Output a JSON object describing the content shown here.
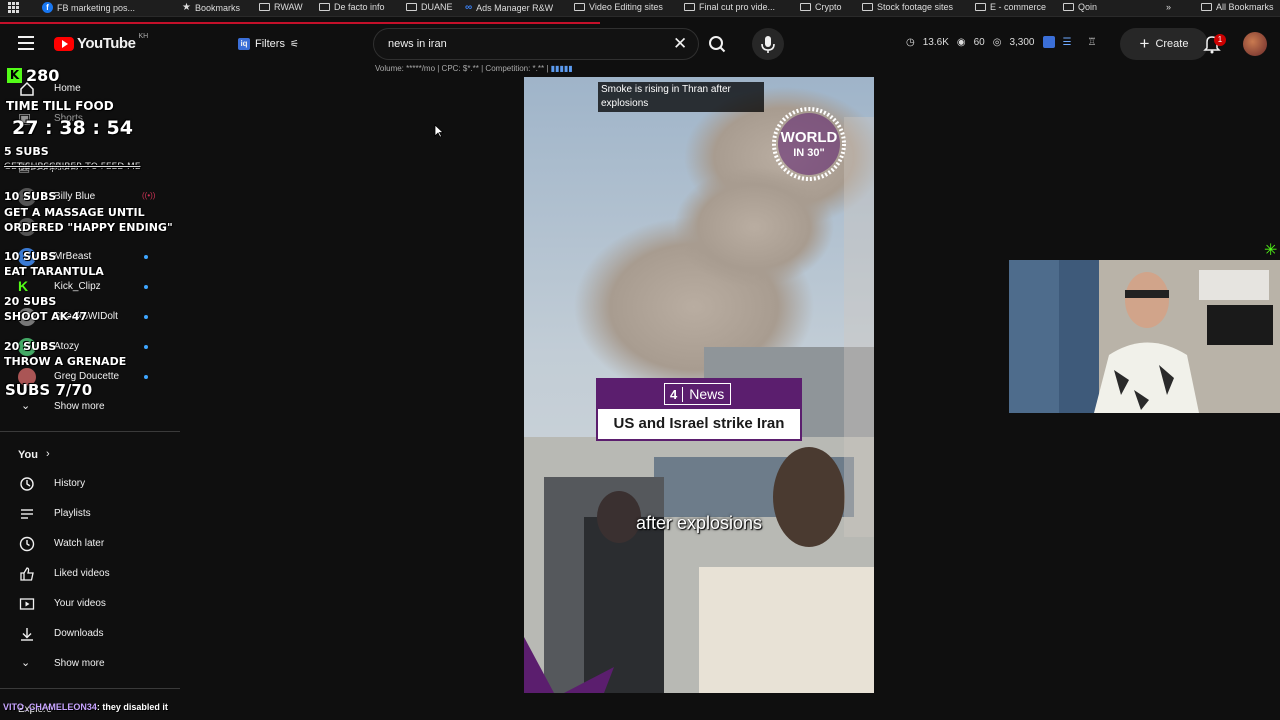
{
  "bookmarks": [
    {
      "label": "",
      "icon": "apps-grid-icon"
    },
    {
      "label": "FB marketing pos...",
      "icon": "facebook-icon"
    },
    {
      "label": "Bookmarks",
      "icon": "star-icon"
    },
    {
      "label": "RWAW",
      "icon": "folder-icon"
    },
    {
      "label": "De facto info",
      "icon": "folder-icon"
    },
    {
      "label": "DUANE",
      "icon": "folder-icon"
    },
    {
      "label": "Ads Manager R&W",
      "icon": "meta-icon"
    },
    {
      "label": "Video Editing sites",
      "icon": "folder-icon"
    },
    {
      "label": "Final cut pro vide...",
      "icon": "folder-icon"
    },
    {
      "label": "Crypto",
      "icon": "folder-icon"
    },
    {
      "label": "Stock footage sites",
      "icon": "folder-icon"
    },
    {
      "label": "E - commerce",
      "icon": "folder-icon"
    },
    {
      "label": "Qoin",
      "icon": "folder-icon"
    },
    {
      "label": "All Bookmarks",
      "icon": "folder-icon"
    }
  ],
  "header": {
    "logo": "YouTube",
    "country": "KH",
    "filters_label": "Filters",
    "search_value": "news in iran",
    "seo_bar": "Volume: *****/mo | CPC: $*.** | Competition: *.** |",
    "stats": {
      "views": "13.6K",
      "eye": "60",
      "subs": "3,300"
    },
    "create_label": "Create",
    "notifications": "1"
  },
  "sidebar": {
    "top_items": [
      {
        "label": "Home",
        "icon": "home-icon"
      },
      {
        "label": "Shorts",
        "icon": "shorts-icon"
      },
      {
        "label": "Subscriptions",
        "icon": "subscriptions-icon"
      }
    ],
    "subscriptions": [
      {
        "label": "Billy Blue",
        "live": true
      },
      {
        "label": "",
        "live": false
      },
      {
        "label": "MrBeast",
        "live": true
      },
      {
        "label": "Kick_Clipz",
        "live": true
      },
      {
        "label": "SneakoWIDolt",
        "live": true
      },
      {
        "label": "Atozy",
        "live": true
      },
      {
        "label": "Greg Doucette",
        "live": true
      }
    ],
    "show_more_1": "Show more",
    "you_header": "You",
    "you_items": [
      {
        "label": "History",
        "icon": "history-icon"
      },
      {
        "label": "Playlists",
        "icon": "playlists-icon"
      },
      {
        "label": "Watch later",
        "icon": "watch-later-icon"
      },
      {
        "label": "Liked videos",
        "icon": "thumbs-up-icon"
      },
      {
        "label": "Your videos",
        "icon": "your-videos-icon"
      },
      {
        "label": "Downloads",
        "icon": "download-icon"
      }
    ],
    "show_more_2": "Show more",
    "footer": "Explore"
  },
  "overlay": {
    "kick_count": "280",
    "timer_title": "TIME TILL FOOD",
    "timer": "27 : 38 : 54",
    "goals": [
      {
        "subs": "5 SUBS",
        "task": "GET SUBSCRIBER TO FEED ME"
      },
      {
        "subs": "10 SUBS",
        "task": "GET A MASSAGE UNTIL ORDERED \"HAPPY ENDING\""
      },
      {
        "subs": "10 SUBS",
        "task": "EAT TARANTULA"
      },
      {
        "subs": "20 SUBS",
        "task": "SHOOT AK-47"
      },
      {
        "subs": "20 SUBS",
        "task": "THROW A GRENADE"
      }
    ],
    "subs_progress": "SUBS 7/70",
    "chat": {
      "user": "VITO_CHAMELEON34",
      "message": ": they disabled it"
    }
  },
  "video": {
    "top_caption": "Smoke is rising in Thran after explosions",
    "world_badge": "WORLD",
    "world_badge_sub": "IN 30\"",
    "news_logo_num": "4",
    "news_logo": "News",
    "headline": "US and Israel strike Iran",
    "subtitle": "after explosions"
  },
  "colors": {
    "bg": "#0f0f0f",
    "youtube_red": "#ff0000",
    "kick_green": "#53fc18",
    "news_purple": "#5b1e6e",
    "live_dot": "#3ea6ff"
  }
}
